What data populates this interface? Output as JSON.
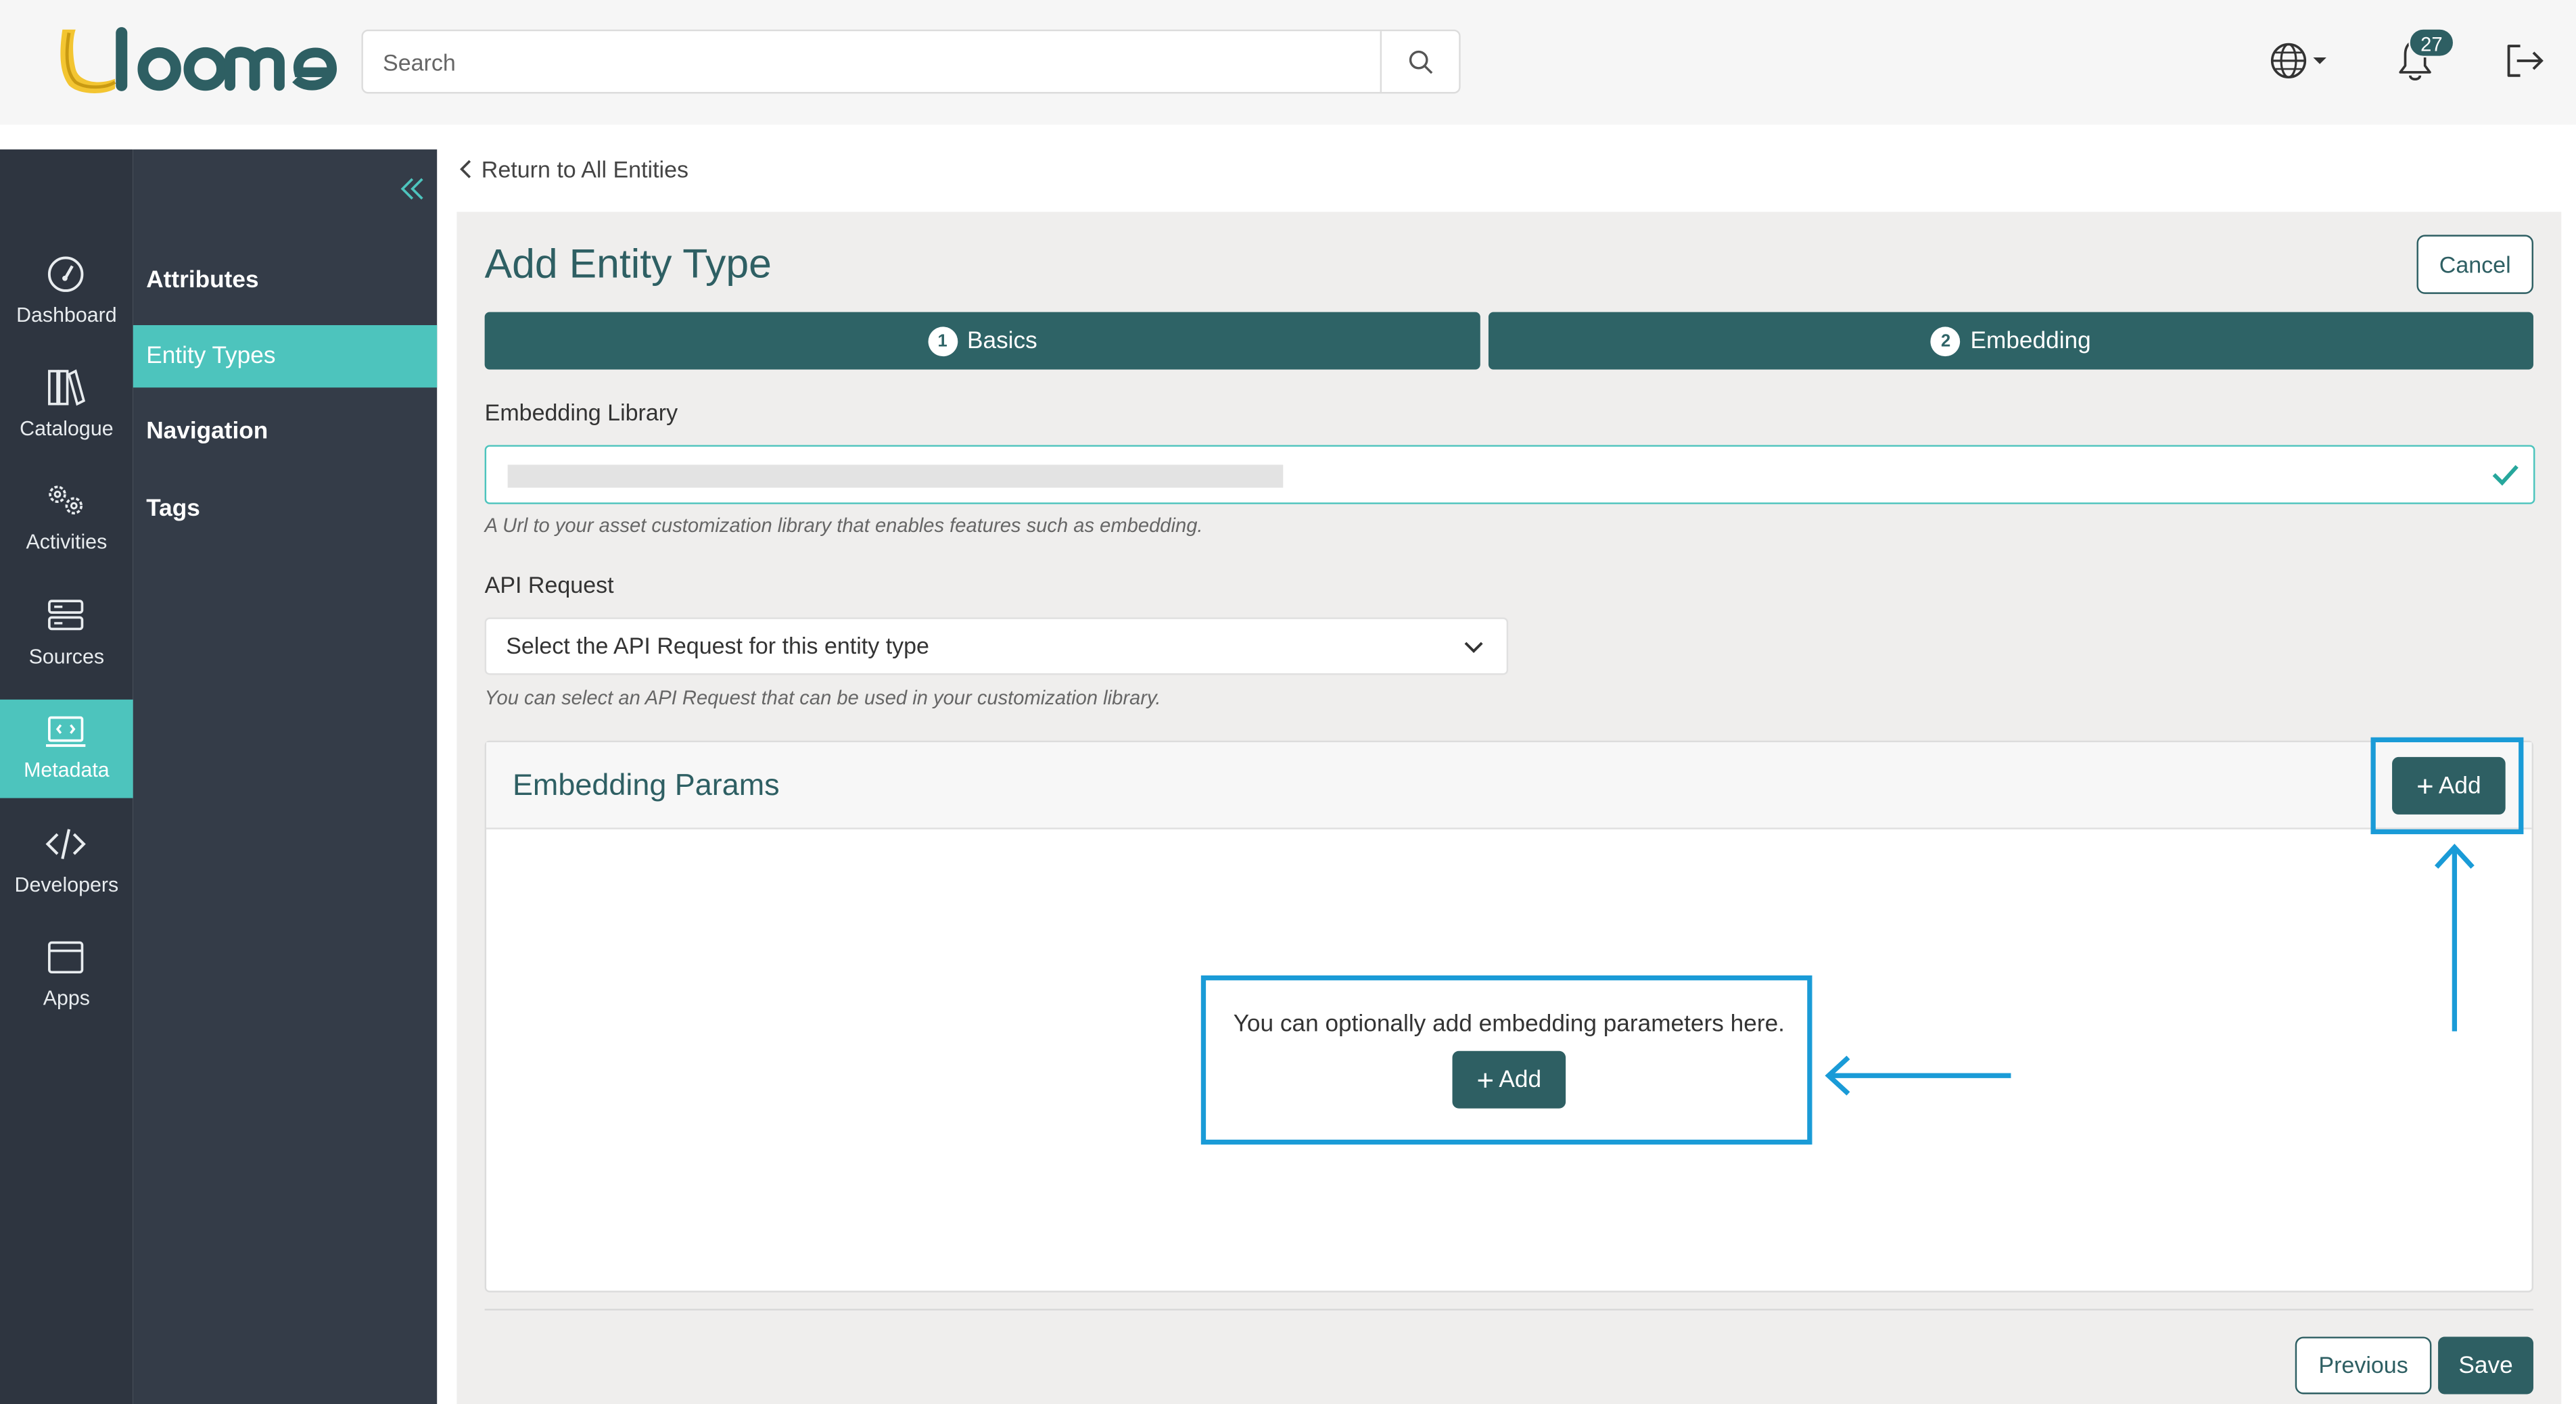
{
  "header": {
    "logo_text": "loome",
    "search_placeholder": "Search",
    "notification_count": "27"
  },
  "rail": {
    "items": [
      {
        "label": "Dashboard",
        "icon": "dashboard-icon"
      },
      {
        "label": "Catalogue",
        "icon": "catalogue-icon"
      },
      {
        "label": "Activities",
        "icon": "activities-icon"
      },
      {
        "label": "Sources",
        "icon": "sources-icon"
      },
      {
        "label": "Metadata",
        "icon": "metadata-icon",
        "active": true
      },
      {
        "label": "Developers",
        "icon": "developers-icon"
      },
      {
        "label": "Apps",
        "icon": "apps-icon"
      }
    ]
  },
  "submenu": {
    "items": [
      {
        "label": "Attributes"
      },
      {
        "label": "Entity Types",
        "active": true
      },
      {
        "label": "Navigation"
      },
      {
        "label": "Tags"
      }
    ]
  },
  "content": {
    "return_link": "Return to All Entities",
    "title": "Add Entity Type",
    "cancel": "Cancel",
    "steps": [
      {
        "num": "1",
        "label": "Basics"
      },
      {
        "num": "2",
        "label": "Embedding"
      }
    ],
    "embedding_library": {
      "label": "Embedding Library",
      "hint": "A Url to your asset customization library that enables features such as embedding."
    },
    "api_request": {
      "label": "API Request",
      "selected": "Select the API Request for this entity type",
      "hint": "You can select an API Request that can be used in your customization library."
    },
    "embedding_params": {
      "title": "Embedding Params",
      "add": "Add",
      "empty_text": "You can optionally add embedding parameters here.",
      "empty_add": "Add"
    },
    "previous": "Previous",
    "save": "Save"
  },
  "colors": {
    "brand_dark": "#2e5f63",
    "brand_teal": "#4dc4bd",
    "rail_bg": "#2e3540",
    "annotation": "#1a9bd7"
  }
}
